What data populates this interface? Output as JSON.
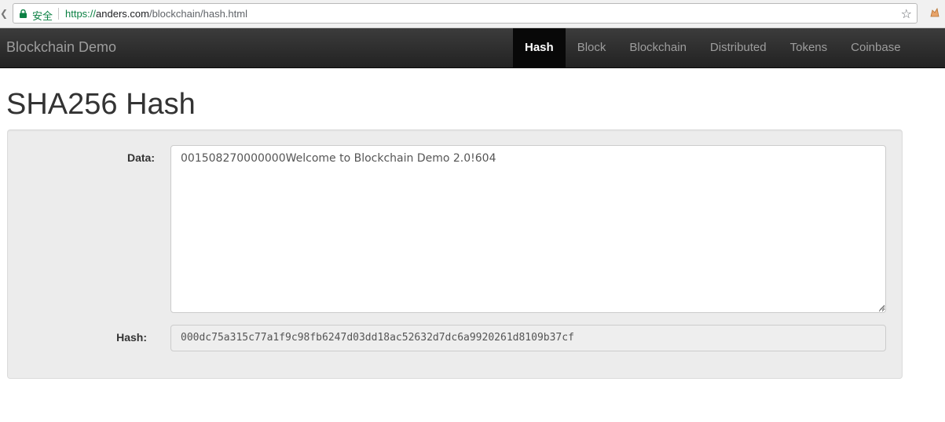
{
  "browser": {
    "secure_label": "安全",
    "url_scheme": "https://",
    "url_host": "anders.com",
    "url_path": "/blockchain/hash.html"
  },
  "navbar": {
    "brand": "Blockchain Demo",
    "items": [
      {
        "label": "Hash",
        "active": true
      },
      {
        "label": "Block",
        "active": false
      },
      {
        "label": "Blockchain",
        "active": false
      },
      {
        "label": "Distributed",
        "active": false
      },
      {
        "label": "Tokens",
        "active": false
      },
      {
        "label": "Coinbase",
        "active": false
      }
    ],
    "active_bg": "#080808",
    "bar_color": "#222222"
  },
  "page": {
    "title": "SHA256 Hash"
  },
  "form": {
    "data_label": "Data:",
    "data_value": "001508270000000Welcome to Blockchain Demo 2.0!604",
    "hash_label": "Hash:",
    "hash_value": "000dc75a315c77a1f9c98fb6247d03dd18ac52632d7dc6a9920261d8109b37cf"
  },
  "icons": {
    "lock": "lock-icon",
    "star": "bookmark-star-icon",
    "extension": "extension-icon"
  },
  "colors": {
    "secure_green": "#0b8043",
    "well_bg": "#ececec"
  }
}
